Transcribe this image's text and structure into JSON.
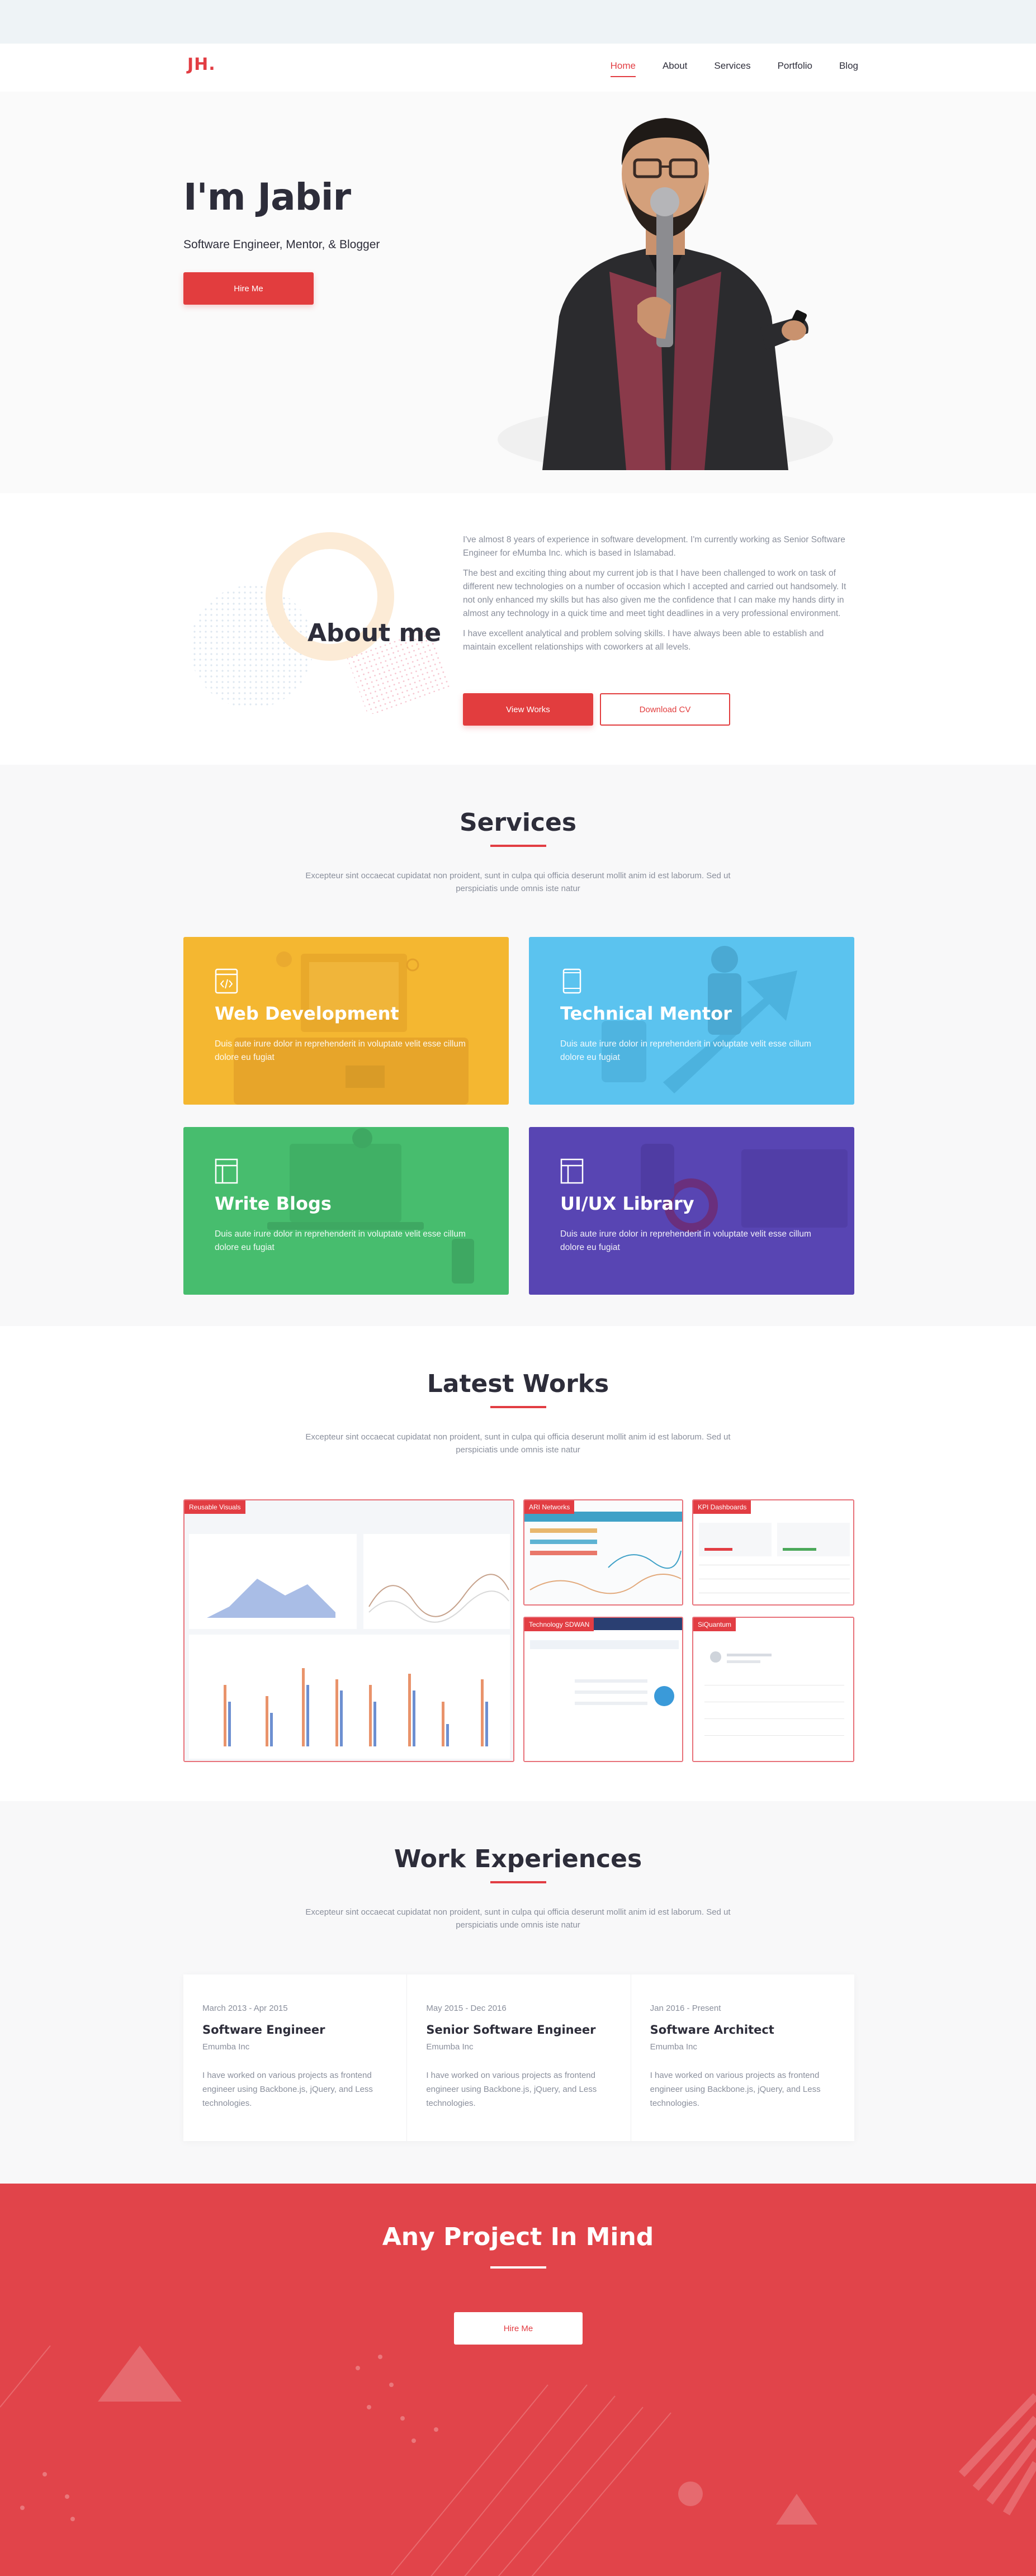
{
  "nav": {
    "logo": "JH.",
    "links": [
      "Home",
      "About",
      "Services",
      "Portfolio",
      "Blog"
    ]
  },
  "hero": {
    "title": "I'm Jabir",
    "subtitle": "Software Engineer, Mentor, & Blogger",
    "cta": "Hire Me"
  },
  "about": {
    "title": "About me",
    "paragraphs": [
      "I've almost 8 years of experience in software development. I'm currently working as Senior Software Engineer for eMumba Inc. which is based in Islamabad.",
      "The best and exciting thing about my current job is that I have been challenged to work on task of different new technologies on a number of occasion which I accepted and carried out handsomely. It not only enhanced my skills but has also given me the confidence that I can make my hands dirty in almost any technology in a quick time and meet tight deadlines in a very professional environment.",
      "I have excellent analytical and problem solving skills. I have always been able to establish and maintain excellent relationships with coworkers at all levels."
    ],
    "btn_primary": "View Works",
    "btn_secondary": "Download CV"
  },
  "services": {
    "title": "Services",
    "desc": "Excepteur sint occaecat cupidatat non proident, sunt in culpa qui officia deserunt mollit anim id est laborum. Sed ut perspiciatis unde omnis iste natur",
    "cards": [
      {
        "title": "Web Development",
        "text": "Duis aute irure dolor in reprehenderit in voluptate velit esse cillum dolore eu fugiat",
        "color": "#f4b731",
        "icon": "browser-code-icon"
      },
      {
        "title": "Technical Mentor",
        "text": "Duis aute irure dolor in reprehenderit in voluptate velit esse cillum dolore eu fugiat",
        "color": "#5bc3ef",
        "icon": "tablet-icon"
      },
      {
        "title": "Write Blogs",
        "text": "Duis aute irure dolor in reprehenderit in voluptate velit esse cillum dolore eu fugiat",
        "color": "#47bd6e",
        "icon": "layout-icon"
      },
      {
        "title": "UI/UX Library",
        "text": "Duis aute irure dolor in reprehenderit in voluptate velit esse cillum dolore eu fugiat",
        "color": "#5845b3",
        "icon": "layout-icon"
      }
    ]
  },
  "works": {
    "title": "Latest Works",
    "desc": "Excepteur sint occaecat cupidatat non proident, sunt in culpa qui officia deserunt mollit anim id est laborum. Sed ut perspiciatis unde omnis iste natur",
    "items": [
      "Reusable Visuals",
      "ARI Networks",
      "KPI Dashboards",
      "Technology SDWAN",
      "SiQuantum"
    ]
  },
  "experience": {
    "title": "Work Experiences",
    "desc": "Excepteur sint occaecat cupidatat non proident, sunt in culpa qui officia deserunt mollit anim id est laborum. Sed ut perspiciatis unde omnis iste natur",
    "items": [
      {
        "date": "March 2013 - Apr 2015",
        "role": "Software Engineer",
        "company": "Emumba Inc",
        "desc": "I have worked on various projects as frontend engineer using Backbone.js, jQuery, and Less technologies."
      },
      {
        "date": "May 2015 - Dec 2016",
        "role": "Senior Software Engineer",
        "company": "Emumba Inc",
        "desc": "I have worked on various projects as frontend engineer using Backbone.js, jQuery, and Less technologies."
      },
      {
        "date": "Jan 2016 - Present",
        "role": "Software Architect",
        "company": "Emumba Inc",
        "desc": "I have worked on various projects as frontend engineer using Backbone.js, jQuery, and Less technologies."
      }
    ]
  },
  "cta": {
    "title": "Any Project In Mind",
    "button": "Hire Me"
  },
  "colors": {
    "accent": "#e23d43",
    "cta_bg": "#e1444a"
  }
}
